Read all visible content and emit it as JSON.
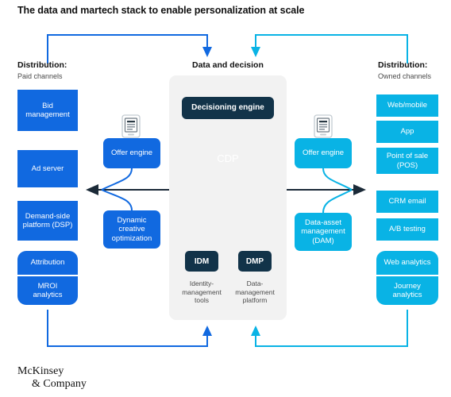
{
  "title": "The data and martech stack to enable personalization at scale",
  "colors": {
    "blue": "#1169e0",
    "cyan": "#09b3e5",
    "navy": "#123349",
    "panel": "#f2f2f2",
    "arrow_dark": "#1b2a38",
    "text_dark": "#111111",
    "text_muted": "#4a4a4a"
  },
  "columns": {
    "left": {
      "heading": "Distribution:",
      "subheading": "Paid channels"
    },
    "center": {
      "heading": "Data and decision",
      "subheading": ""
    },
    "right": {
      "heading": "Distribution:",
      "subheading": "Owned channels"
    }
  },
  "left_column": {
    "boxes": [
      {
        "label": "Bid\nmanagement",
        "color": "blue",
        "shape": "rect"
      },
      {
        "label": "Ad server",
        "color": "blue",
        "shape": "rect"
      },
      {
        "label": "Demand-side\nplatform (DSP)",
        "color": "blue",
        "shape": "rect"
      }
    ],
    "pill_group": {
      "color": "blue",
      "segments": [
        "Attribution",
        "MROI\nanalytics"
      ]
    }
  },
  "left_mid": {
    "offer_engine": {
      "label": "Offer engine",
      "color": "blue",
      "icon": "tablet-document-icon"
    },
    "dco": {
      "label": "Dynamic\ncreative\noptimization",
      "color": "blue"
    }
  },
  "center": {
    "gear_icon": "gear-icon",
    "decisioning_engine": "Decisioning engine",
    "connector_icon": "plug-connector-icon",
    "cdp_label": "CDP",
    "database_icon": "database-stack-icon",
    "idm": {
      "label": "IDM",
      "caption": "Identity-\nmanagement\ntools"
    },
    "dmp": {
      "label": "DMP",
      "caption": "Data-\nmanagement\nplatform"
    }
  },
  "right_mid": {
    "offer_engine": {
      "label": "Offer engine",
      "color": "cyan",
      "icon": "tablet-document-icon"
    },
    "dam": {
      "label": "Data-asset\nmanagement\n(DAM)",
      "color": "cyan"
    }
  },
  "right_column": {
    "boxes": [
      {
        "label": "Web/mobile",
        "color": "cyan",
        "shape": "rect"
      },
      {
        "label": "App",
        "color": "cyan",
        "shape": "rect"
      },
      {
        "label": "Point of sale\n(POS)",
        "color": "cyan",
        "shape": "rect"
      },
      {
        "label": "CRM email",
        "color": "cyan",
        "shape": "rect"
      },
      {
        "label": "A/B testing",
        "color": "cyan",
        "shape": "rect"
      }
    ],
    "pill_group": {
      "color": "cyan",
      "segments": [
        "Web analytics",
        "Journey\nanalytics"
      ]
    }
  },
  "logo": {
    "line1": "McKinsey",
    "line2": "& Company"
  }
}
